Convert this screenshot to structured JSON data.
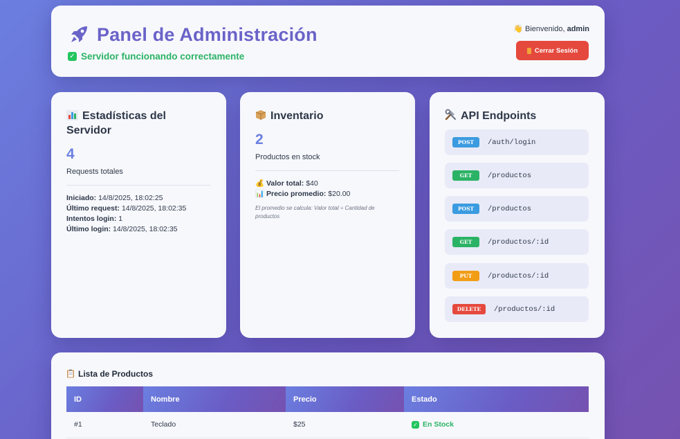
{
  "header": {
    "title": "Panel de Administración",
    "status": "Servidor funcionando correctamente",
    "welcome_prefix": "Bienvenido,",
    "username": "admin",
    "logout_label": "Cerrar Sesión",
    "icons": [
      "rocket-icon",
      "check-icon",
      "wave-hand-icon",
      "door-icon"
    ]
  },
  "stats": {
    "title": "Estadísticas del Servidor",
    "icon": "bar-chart-icon",
    "requests_total": "4",
    "requests_label": "Requests totales",
    "rows": [
      {
        "label": "Iniciado:",
        "value": "14/8/2025, 18:02:25"
      },
      {
        "label": "Último request:",
        "value": "14/8/2025, 18:02:35"
      },
      {
        "label": "Intentos login:",
        "value": "1"
      },
      {
        "label": "Último login:",
        "value": "14/8/2025, 18:02:35"
      }
    ]
  },
  "inventory": {
    "title": "Inventario",
    "icon": "package-icon",
    "stock_count": "2",
    "stock_label": "Productos en stock",
    "total_label": "Valor total:",
    "total_value": "$40",
    "avg_label": "Precio promedio:",
    "avg_value": "$20.00",
    "note": "El promedio se calcula: Valor total ÷ Cantidad de productos"
  },
  "api": {
    "title": "API Endpoints",
    "icon": "tools-icon",
    "endpoints": [
      {
        "method": "POST",
        "path": "/auth/login"
      },
      {
        "method": "GET",
        "path": "/productos"
      },
      {
        "method": "POST",
        "path": "/productos"
      },
      {
        "method": "GET",
        "path": "/productos/:id"
      },
      {
        "method": "PUT",
        "path": "/productos/:id"
      },
      {
        "method": "DELETE",
        "path": "/productos/:id"
      }
    ]
  },
  "products": {
    "title": "Lista de Productos",
    "icon": "clipboard-icon",
    "columns": [
      "ID",
      "Nombre",
      "Precio",
      "Estado"
    ],
    "rows": [
      {
        "id": "#1",
        "name": "Teclado",
        "price": "$25",
        "status": "En Stock"
      }
    ]
  },
  "colors": {
    "accent": "#6a63c8",
    "success": "#2bb365",
    "danger": "#e5493d",
    "post": "#3b9be0",
    "get": "#2bb365",
    "put": "#f29d16",
    "delete": "#e5493d"
  }
}
